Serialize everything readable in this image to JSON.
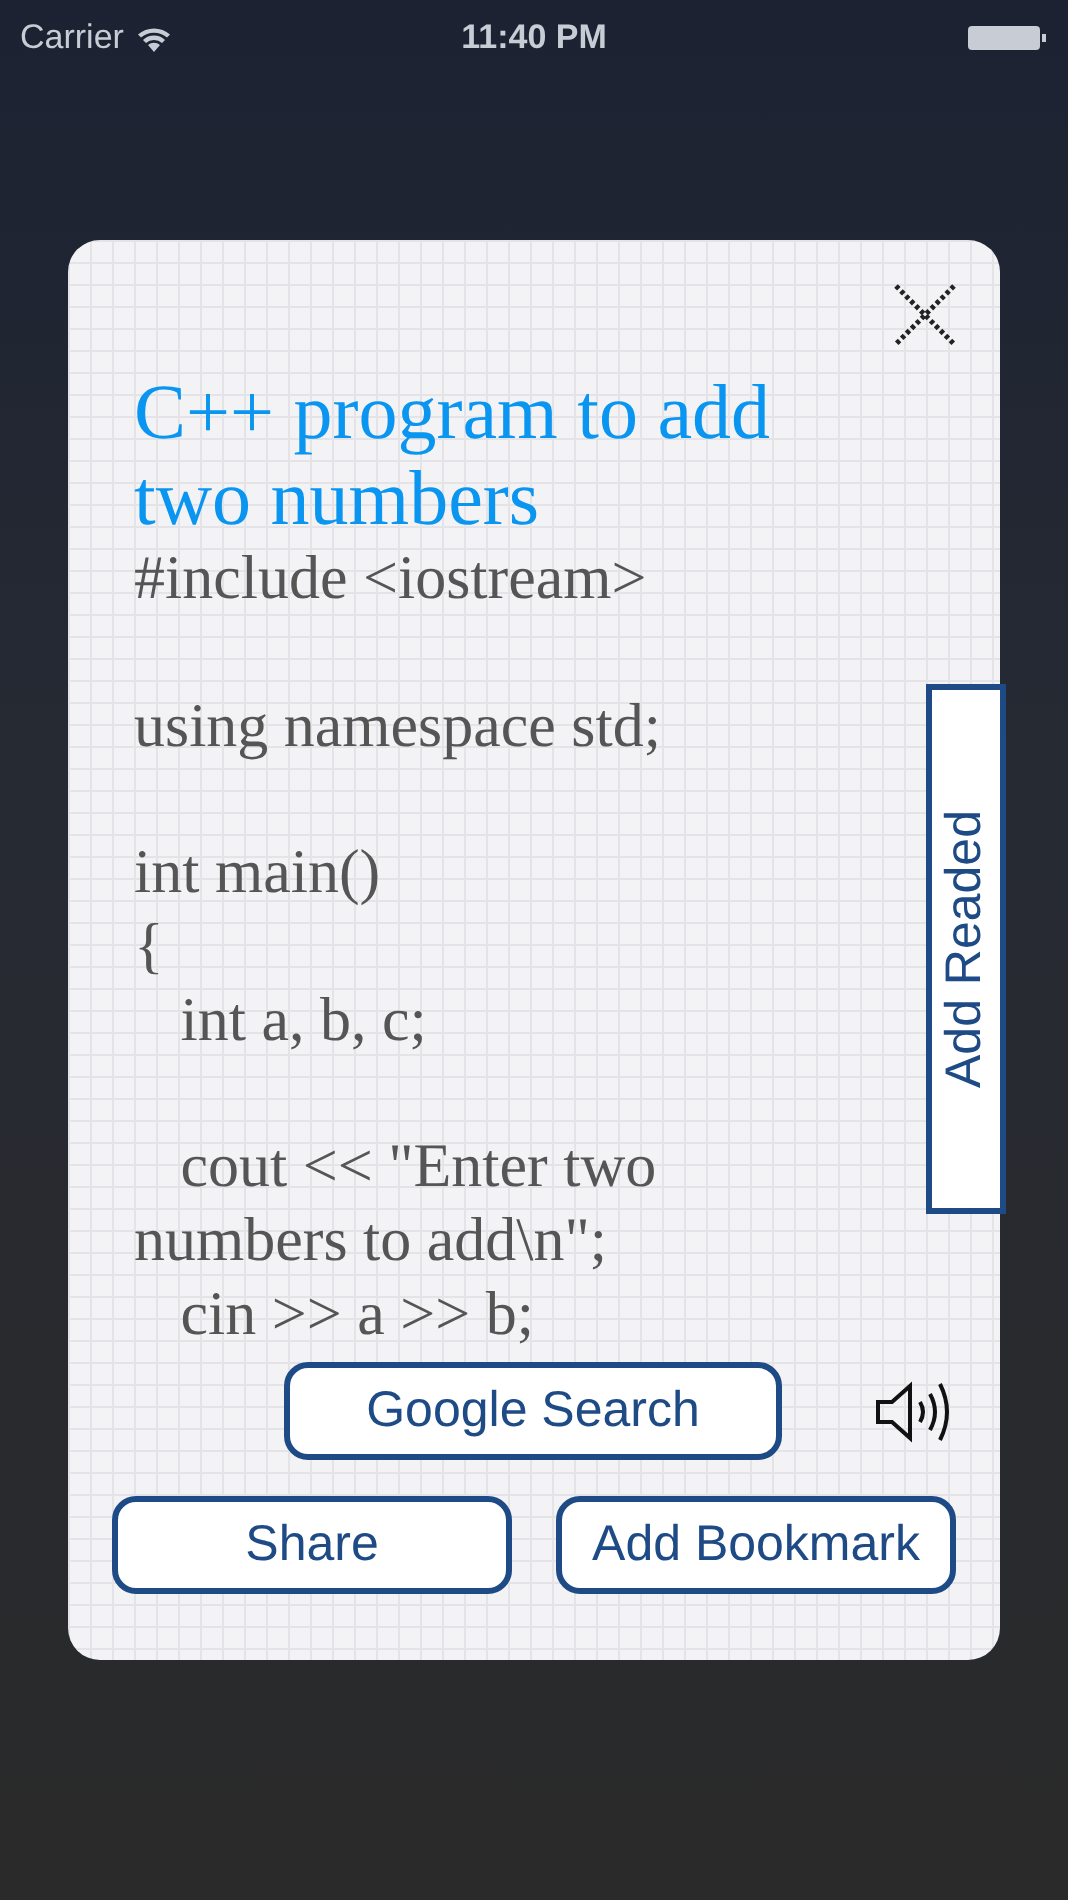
{
  "status_bar": {
    "carrier": "Carrier",
    "time": "11:40 PM"
  },
  "card": {
    "title": "C++ program to add two numbers",
    "code": "#include <iostream>\n\nusing namespace std;\n\nint main()\n{\n   int a, b, c;\n\n   cout << \"Enter two numbers to add\\n\";\n   cin >> a >> b;",
    "add_readed_button": "Add Readed",
    "google_search_button": "Google Search",
    "share_button": "Share",
    "add_bookmark_button": "Add Bookmark"
  }
}
